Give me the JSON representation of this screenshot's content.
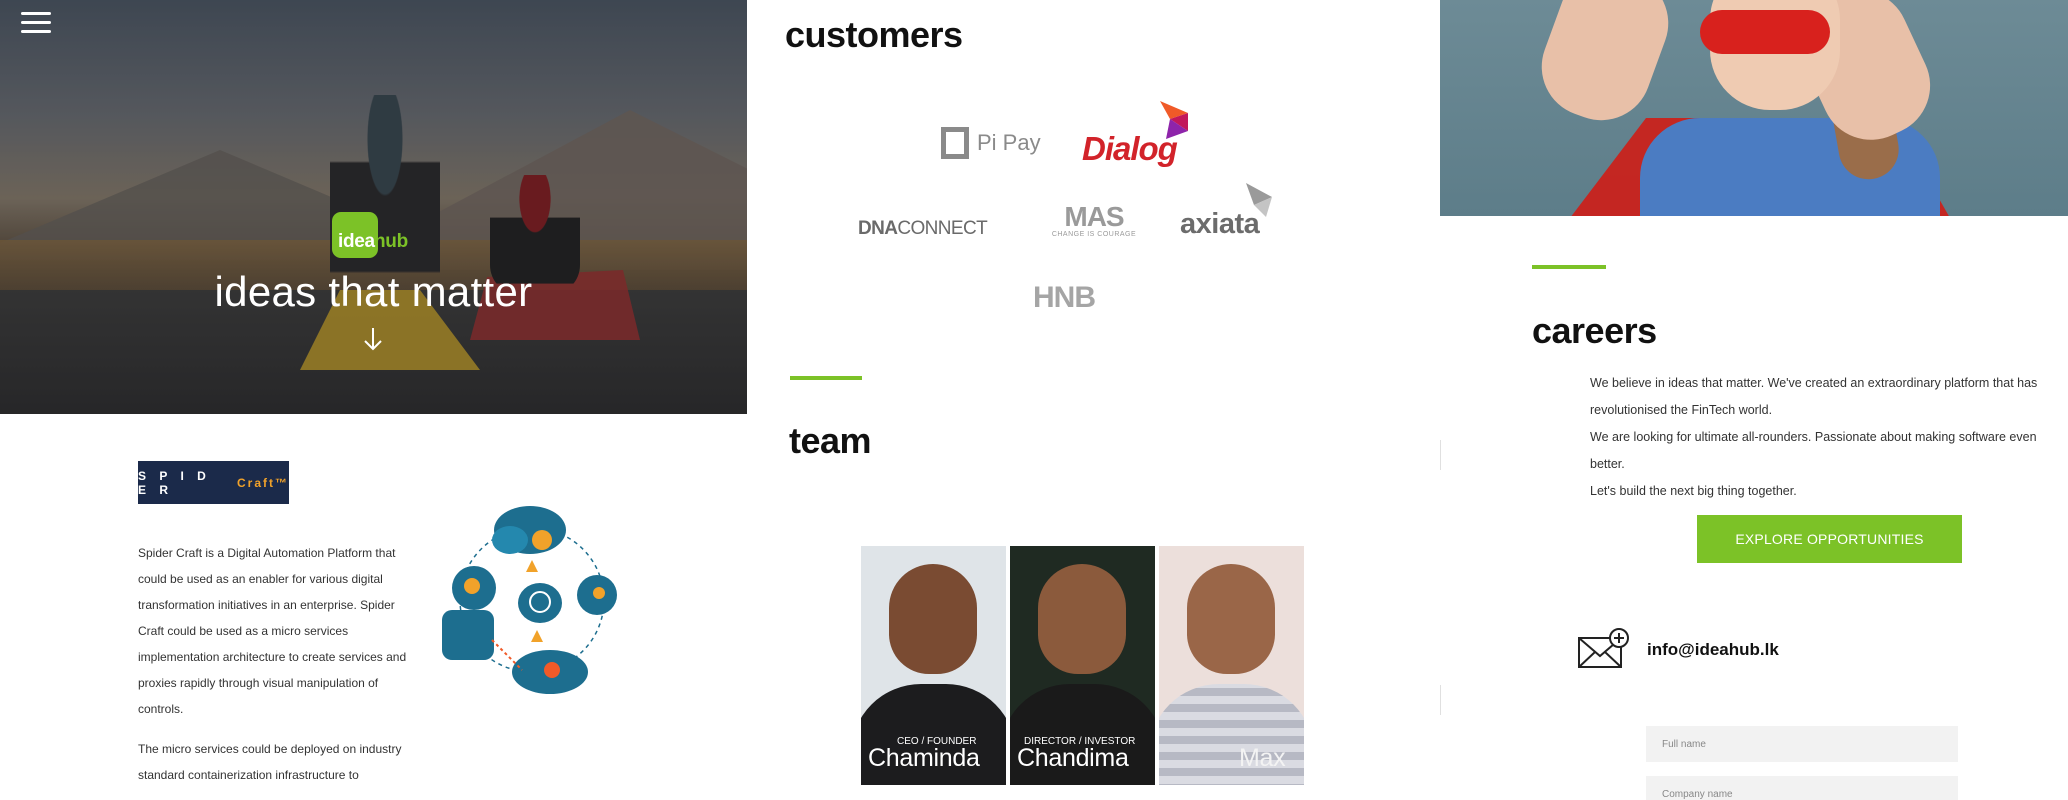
{
  "hero": {
    "logo_idea": "idea",
    "logo_hub": "hub",
    "title": "ideas that matter"
  },
  "spidercraft": {
    "logo_spider": "S P I D E R",
    "logo_craft": "Craft™",
    "paragraph_1": "Spider Craft is a Digital Automation Platform that could be used as an enabler for various digital transformation initiatives in an enterprise. Spider Craft could be used as a micro services implementation architecture to create services and proxies rapidly through visual manipulation of controls.",
    "paragraph_2": "The micro services could be deployed on industry standard containerization infrastructure to"
  },
  "customers": {
    "title": "customers",
    "logos": {
      "pipay": "Pi Pay",
      "dialog": "Dialog",
      "dna_bold": "DNA",
      "dna_thin": "CONNECT",
      "mas": "MAS",
      "mas_tagline": "CHANGE IS COURAGE",
      "axiata": "axiata",
      "hnb": "HNB"
    }
  },
  "team": {
    "title": "team",
    "members": [
      {
        "role": "CEO / FOUNDER",
        "name": "Chaminda"
      },
      {
        "role": "DIRECTOR / INVESTOR",
        "name": "Chandima"
      },
      {
        "role": "",
        "name": "Max"
      }
    ]
  },
  "careers": {
    "title": "careers",
    "line_1": "We believe in ideas that matter. We've created an extraordinary platform that has revolutionised the FinTech world.",
    "line_2": "We are looking for ultimate all-rounders. Passionate about making software even better.",
    "line_3": "Let's build the next big thing together.",
    "button_label": "EXPLORE OPPORTUNITIES"
  },
  "contact": {
    "email": "info@ideahub.lk",
    "fullname_placeholder": "Full name",
    "company_placeholder": "Company name"
  },
  "colors": {
    "accent_green": "#7cc227",
    "spider_navy": "#1b2a4a",
    "dialog_red": "#d2232a"
  }
}
